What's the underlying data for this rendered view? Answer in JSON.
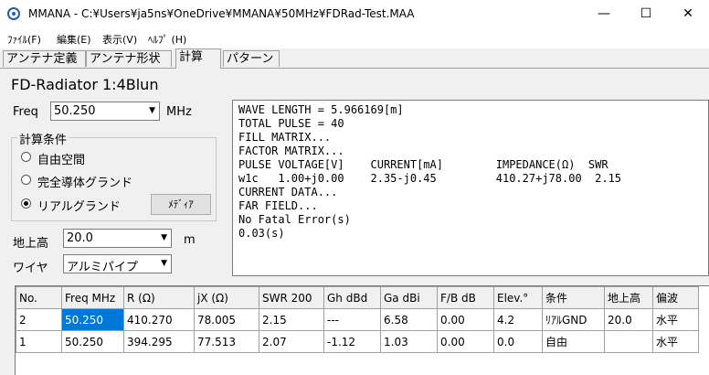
{
  "window": {
    "title": "MMANA - C:¥Users¥ja5ns¥OneDrive¥MMANA¥50MHz¥FDRad-Test.MAA",
    "minimize_icon": "minimize-icon",
    "maximize_icon": "maximize-icon",
    "close_icon": "close-icon"
  },
  "menu": [
    {
      "label": "ﾌｧｲﾙ(F)"
    },
    {
      "label": "編集(E)"
    },
    {
      "label": "表示(V)"
    },
    {
      "label": "ﾍﾙﾌﾟ (H)"
    }
  ],
  "tabs": [
    {
      "label": "アンテナ定義"
    },
    {
      "label": "アンテナ形状"
    },
    {
      "label": "計算"
    },
    {
      "label": "パターン"
    }
  ],
  "model_name": "FD-Radiator 1:4Blun",
  "freq": {
    "label": "Freq",
    "value": "50.250",
    "unit": "MHz"
  },
  "calc_conditions": {
    "legend": "計算条件",
    "options": [
      {
        "label": "自由空間",
        "selected": false
      },
      {
        "label": "完全導体グランド",
        "selected": false
      },
      {
        "label": "リアルグランド",
        "selected": true
      }
    ],
    "media_button": "ﾒﾃﾞｨｱ"
  },
  "height": {
    "label": "地上高",
    "value": "20.0",
    "unit": "m"
  },
  "wire": {
    "label": "ワイヤ",
    "value": "アルミパイプ"
  },
  "output_lines": [
    "WAVE LENGTH = 5.966169[m]",
    "TOTAL PULSE = 40",
    "FILL MATRIX...",
    "FACTOR MATRIX...",
    "PULSE VOLTAGE[V]    CURRENT[mA]        IMPEDANCE(Ω)  SWR",
    "w1c   1.00+j0.00    2.35-j0.45         410.27+j78.00  2.15",
    "CURRENT DATA...",
    "FAR FIELD...",
    "No Fatal Error(s)",
    "0.03(s)"
  ],
  "results_table": {
    "headers": [
      "No.",
      "Freq MHz",
      "R (Ω)",
      "jX (Ω)",
      "SWR 200",
      "Gh dBd",
      "Ga dBi",
      "F/B dB",
      "Elev.°",
      "条件",
      "地上高",
      "偏波"
    ],
    "rows": [
      [
        "2",
        "50.250",
        "410.270",
        "78.005",
        "2.15",
        "---",
        "6.58",
        "0.00",
        "4.2",
        "ﾘｱﾙGND",
        "20.0",
        "水平"
      ],
      [
        "1",
        "50.250",
        "394.295",
        "77.513",
        "2.07",
        "-1.12",
        "1.03",
        "0.00",
        "0.0",
        "自由",
        "",
        "水平"
      ]
    ]
  },
  "colors": {
    "selection": "#0078d7"
  }
}
